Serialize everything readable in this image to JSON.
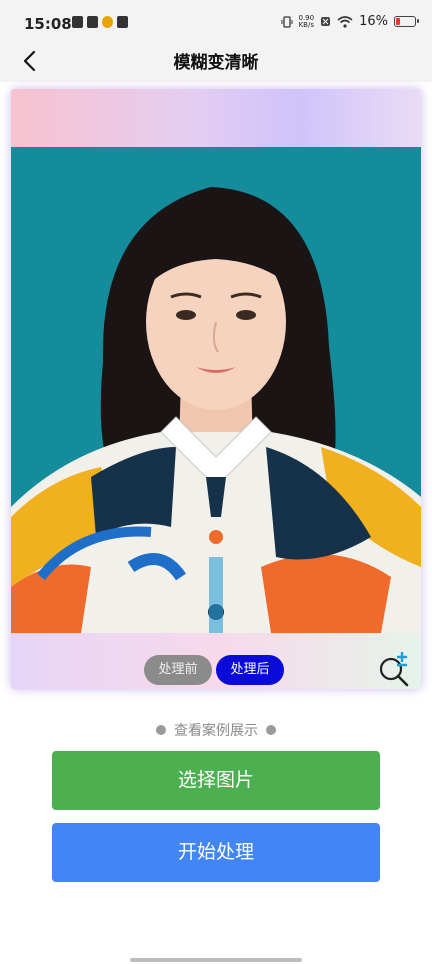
{
  "status": {
    "time": "15:08",
    "net_speed_value": "0.90",
    "net_speed_unit": "KB/s",
    "battery": "16%"
  },
  "header": {
    "title": "模糊变清晰",
    "back_icon": "chevron-left-icon"
  },
  "card": {
    "toggle_before": "处理前",
    "toggle_after": "处理后",
    "zoom_icon": "zoom-in-icon",
    "image": "portrait-photo"
  },
  "case_link": "查看案例展示",
  "buttons": {
    "select": "选择图片",
    "start": "开始处理"
  },
  "colors": {
    "select_button": "#4caf50",
    "start_button": "#4285f4",
    "toggle_active": "#0b0bd9",
    "toggle_inactive": "#8b8b8b",
    "photo_background": "#158c9c"
  }
}
